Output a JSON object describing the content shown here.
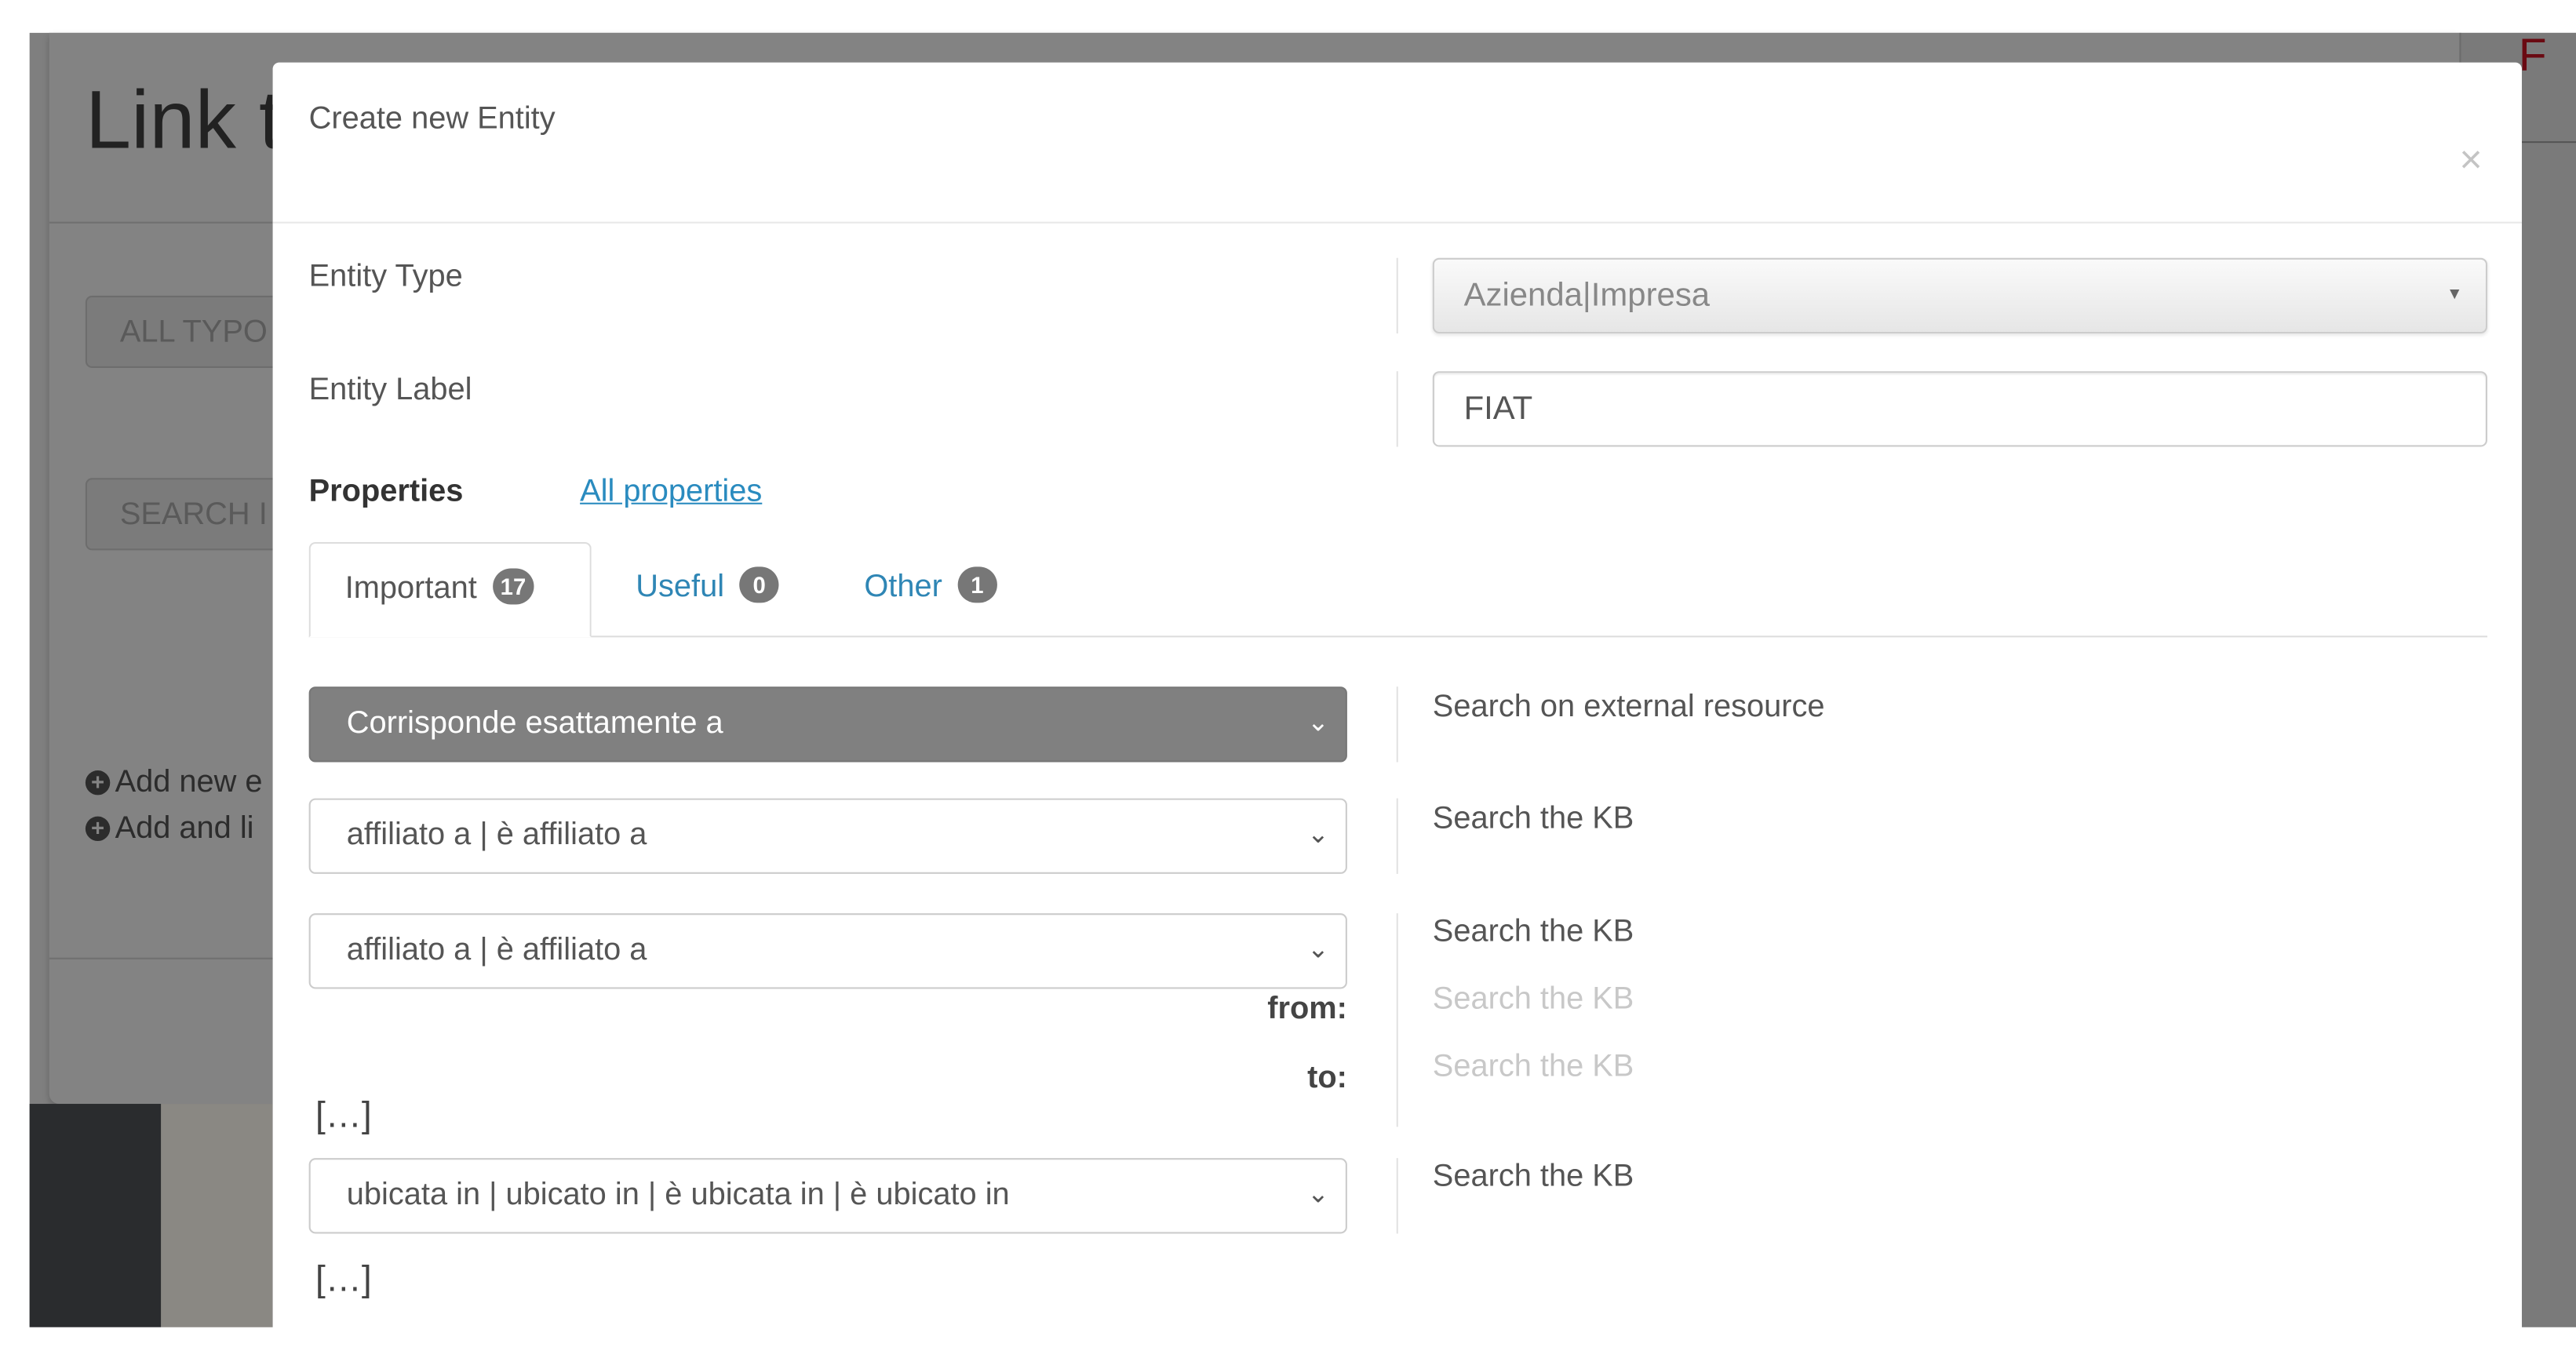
{
  "background": {
    "page_title": "Link t",
    "types_button": "ALL TYPO",
    "search_button": "SEARCH I",
    "add_new": "Add new e",
    "add_and_link": "Add and li",
    "corner_letter": "F"
  },
  "modal": {
    "title": "Create new Entity",
    "close": "×",
    "entity_type_label": "Entity Type",
    "entity_type_value": "Azienda|Impresa",
    "entity_label_label": "Entity Label",
    "entity_label_value": "FIAT",
    "properties_label": "Properties",
    "all_properties_link": "All properties",
    "tabs": [
      {
        "label": "Important",
        "count": "17",
        "active": true
      },
      {
        "label": "Useful",
        "count": "0",
        "active": false
      },
      {
        "label": "Other",
        "count": "1",
        "active": false
      }
    ],
    "rows": [
      {
        "property": "Corrisponde esattamente a",
        "search": "Search on external resource"
      },
      {
        "property": "affiliato a | è affiliato a",
        "search": "Search the KB"
      },
      {
        "property": "affiliato a | è affiliato a",
        "search": "Search the KB",
        "from_label": "from:",
        "from_search": "Search the KB",
        "to_label": "to:",
        "to_search": "Search the KB"
      },
      {
        "property": "ubicata in | ubicato in | è ubicata in | è ubicato in",
        "search": "Search the KB"
      }
    ],
    "ellipsis": "[…]"
  }
}
